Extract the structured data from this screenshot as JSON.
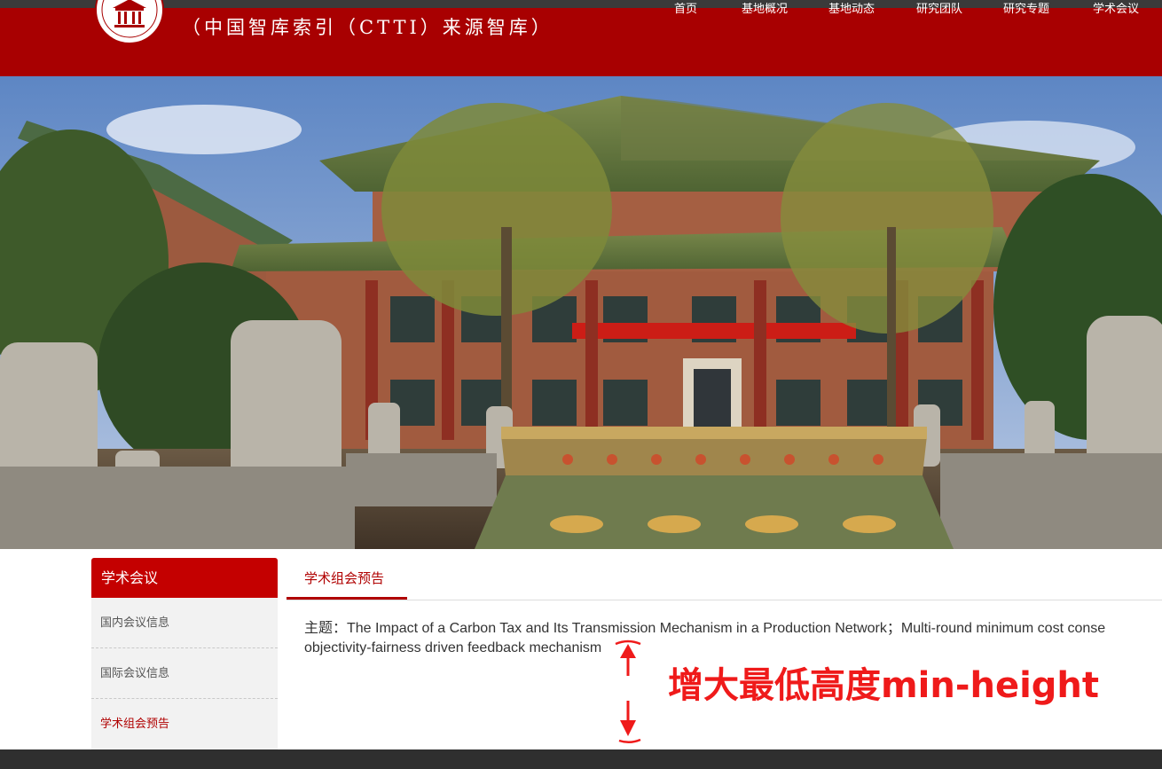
{
  "header": {
    "subtitle": "（中国智库索引（CTTI）来源智库）",
    "nav": [
      "首页",
      "基地概况",
      "基地动态",
      "研究团队",
      "研究专题",
      "学术会议"
    ]
  },
  "sidebar": {
    "title": "学术会议",
    "items": [
      {
        "label": "国内会议信息"
      },
      {
        "label": "国际会议信息"
      },
      {
        "label": "学术组会预告"
      }
    ]
  },
  "main": {
    "tab_label": "学术组会预告",
    "content_line1": "主题：The Impact of a Carbon Tax and Its Transmission Mechanism in a Production Network；Multi-round minimum cost conse",
    "content_line2": "objectivity-fairness driven feedback mechanism"
  },
  "annotation": {
    "text": "增大最低高度min-height",
    "color": "#ef1a1a"
  },
  "colors": {
    "brand_red": "#a80001",
    "accent_red": "#c40000",
    "footer": "#2f2f2f"
  }
}
